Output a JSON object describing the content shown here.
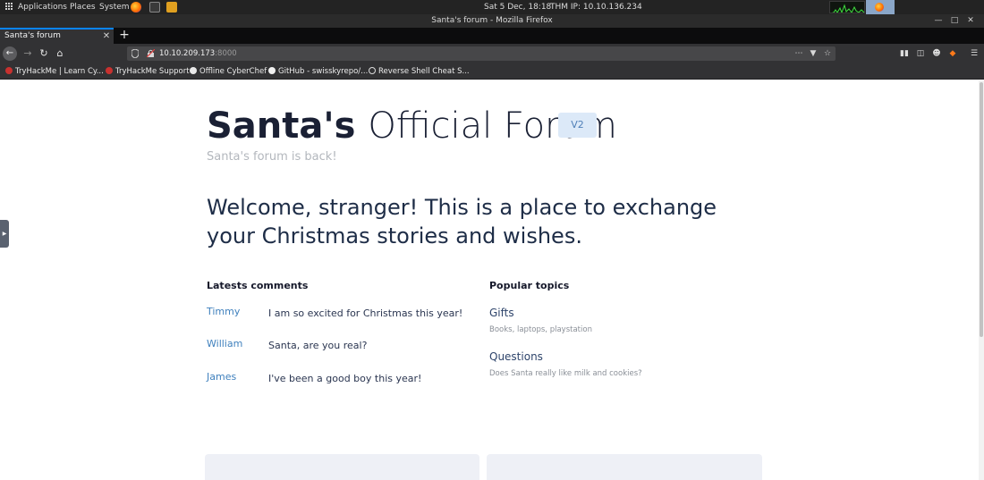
{
  "system_panel": {
    "applications": "Applications",
    "places": "Places",
    "system": "System",
    "clock": "Sat  5 Dec, 18:18",
    "thm_ip": "THM IP:  10.10.136.234"
  },
  "window": {
    "title": "Santa's forum - Mozilla Firefox"
  },
  "tabs": [
    {
      "label": "Santa's forum"
    }
  ],
  "navbar": {
    "url_host": "10.10.209.173",
    "url_port": ":8000"
  },
  "bookmarks": [
    {
      "label": "TryHackMe | Learn Cy...",
      "icon": "tryhackme-icon"
    },
    {
      "label": "TryHackMe Support",
      "icon": "tryhackme-icon"
    },
    {
      "label": "Offline CyberChef",
      "icon": "cyberchef-icon"
    },
    {
      "label": "GitHub - swisskyrepo/...",
      "icon": "github-icon"
    },
    {
      "label": "Reverse Shell Cheat S...",
      "icon": "globe-icon"
    }
  ],
  "page": {
    "title_bold": "Santa's",
    "title_rest": "Official Forum",
    "version": "V2",
    "subtitle": "Santa's forum is back!",
    "welcome": "Welcome, stranger! This is a place to exchange your Christmas stories and wishes.",
    "comments_heading": "Latests comments",
    "comments": [
      {
        "author": "Timmy",
        "text": "I am so excited for Christmas this year!"
      },
      {
        "author": "William",
        "text": "Santa, are you real?"
      },
      {
        "author": "James",
        "text": "I've been a good boy this year!"
      }
    ],
    "topics_heading": "Popular topics",
    "topics": [
      {
        "title": "Gifts",
        "desc": "Books, laptops, playstation"
      },
      {
        "title": "Questions",
        "desc": "Does Santa really like milk and cookies?"
      }
    ]
  },
  "colors": {
    "accent": "#0a84ff",
    "title": "#1a2034",
    "link": "#3f80bd",
    "badge_bg": "#dce9f8"
  }
}
